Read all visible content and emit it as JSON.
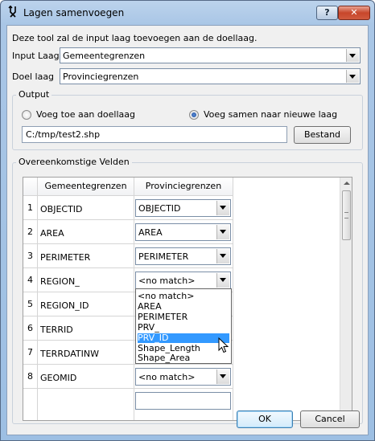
{
  "window": {
    "title": "Lagen samenvoegen",
    "help_label": "?",
    "close_label": "✕"
  },
  "intro_text": "Deze tool zal de input laag toevoegen aan de doellaag.",
  "input_layer": {
    "label": "Input Laag",
    "value": "Gemeentegrenzen"
  },
  "target_layer": {
    "label": "Doel laag",
    "value": "Provinciegrenzen"
  },
  "output": {
    "title": "Output",
    "radio_append": {
      "label": "Voeg toe aan doellaag",
      "checked": false
    },
    "radio_merge": {
      "label": "Voeg samen naar nieuwe laag",
      "checked": true
    },
    "path_value": "C:/tmp/test2.shp",
    "browse_label": "Bestand"
  },
  "fields": {
    "title": "Overeenkomstige Velden",
    "headers": [
      "Gemeentegrenzen",
      "Provinciegrenzen"
    ],
    "rows": [
      {
        "num": "1",
        "source": "OBJECTID",
        "target": "OBJECTID"
      },
      {
        "num": "2",
        "source": "AREA",
        "target": "AREA"
      },
      {
        "num": "3",
        "source": "PERIMETER",
        "target": "PERIMETER"
      },
      {
        "num": "4",
        "source": "REGION_",
        "target": "<no match>"
      },
      {
        "num": "5",
        "source": "REGION_ID",
        "target": ""
      },
      {
        "num": "6",
        "source": "TERRID",
        "target": ""
      },
      {
        "num": "7",
        "source": "TERRDATINW",
        "target": ""
      },
      {
        "num": "8",
        "source": "GEOMID",
        "target": "<no match>"
      }
    ],
    "dropdown_options": [
      "<no match>",
      "AREA",
      "PERIMETER",
      "PRV_",
      "PRV_ID",
      "Shape_Length",
      "Shape_Area"
    ],
    "dropdown_selected": "PRV_ID"
  },
  "buttons": {
    "ok": "OK",
    "cancel": "Cancel"
  },
  "colors": {
    "selection": "#3399ff",
    "titlebar": "#a9c6e6",
    "close": "#c7462b"
  }
}
